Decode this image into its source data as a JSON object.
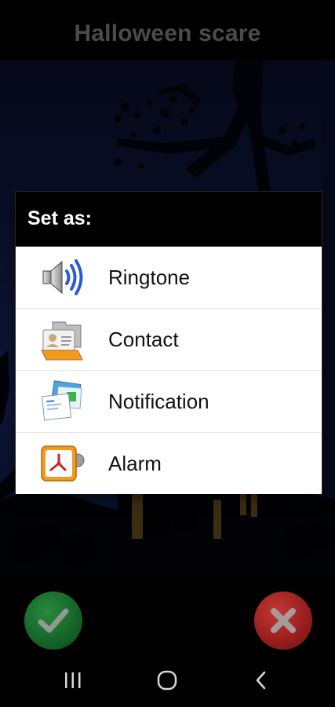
{
  "app": {
    "title": "Halloween scare"
  },
  "dialog": {
    "title": "Set as:",
    "options": [
      {
        "label": "Ringtone",
        "icon": "speaker-volume-icon"
      },
      {
        "label": "Contact",
        "icon": "contact-card-icon"
      },
      {
        "label": "Notification",
        "icon": "notification-messages-icon"
      },
      {
        "label": "Alarm",
        "icon": "alarm-clock-icon"
      }
    ]
  },
  "actions": {
    "confirm_icon": "checkmark-icon",
    "cancel_icon": "x-icon",
    "confirm_color": "#16662a",
    "cancel_color": "#9a1f1f"
  },
  "nav": {
    "recents_icon": "recents-icon",
    "home_icon": "home-icon",
    "back_icon": "back-icon"
  }
}
